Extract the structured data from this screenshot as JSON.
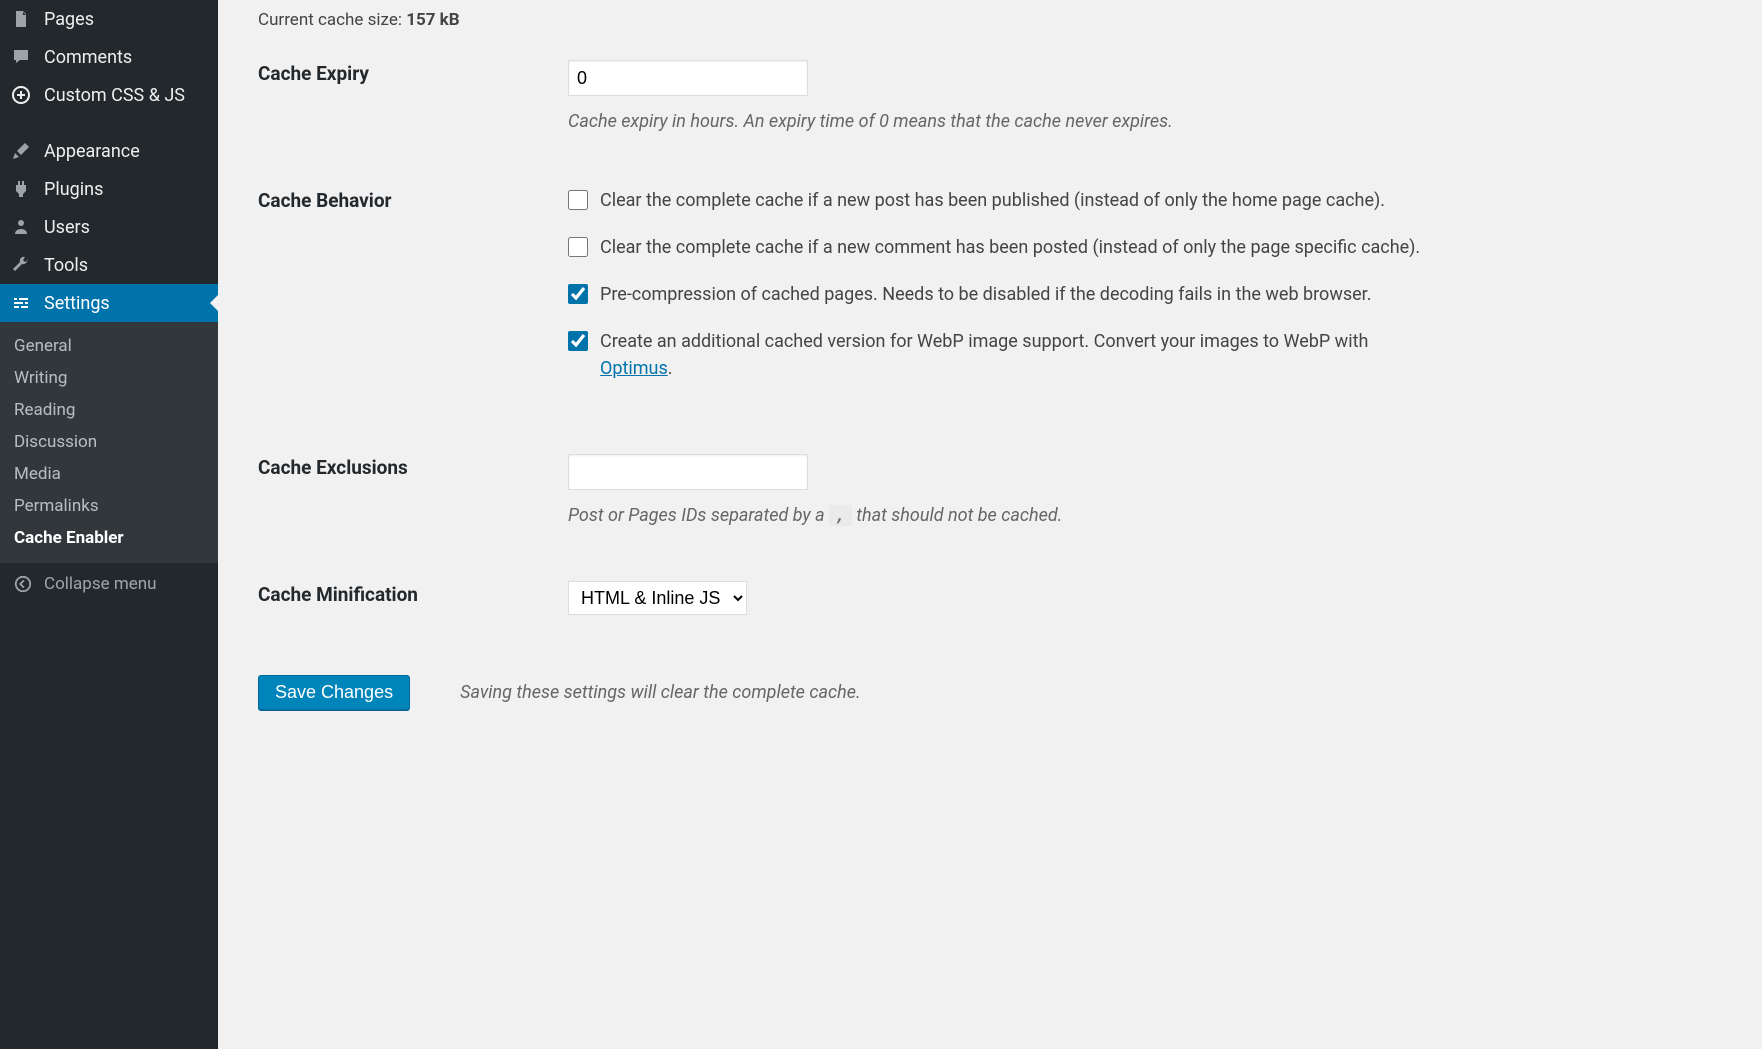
{
  "sidebar": {
    "items": [
      {
        "label": "Pages"
      },
      {
        "label": "Comments"
      },
      {
        "label": "Custom CSS & JS"
      },
      {
        "label": "Appearance"
      },
      {
        "label": "Plugins"
      },
      {
        "label": "Users"
      },
      {
        "label": "Tools"
      },
      {
        "label": "Settings"
      }
    ],
    "submenu": [
      {
        "label": "General"
      },
      {
        "label": "Writing"
      },
      {
        "label": "Reading"
      },
      {
        "label": "Discussion"
      },
      {
        "label": "Media"
      },
      {
        "label": "Permalinks"
      },
      {
        "label": "Cache Enabler"
      }
    ],
    "collapse": "Collapse menu"
  },
  "cacheSize": {
    "label": "Current cache size: ",
    "value": "157 kB"
  },
  "form": {
    "expiry": {
      "label": "Cache Expiry",
      "value": "0",
      "hint": "Cache expiry in hours. An expiry time of 0 means that the cache never expires."
    },
    "behavior": {
      "label": "Cache Behavior",
      "opt1": "Clear the complete cache if a new post has been published (instead of only the home page cache).",
      "opt2": "Clear the complete cache if a new comment has been posted (instead of only the page specific cache).",
      "opt3": "Pre-compression of cached pages. Needs to be disabled if the decoding fails in the web browser.",
      "opt4a": "Create an additional cached version for WebP image support. Convert your images to WebP with ",
      "opt4link": "Optimus",
      "opt4b": "."
    },
    "exclusions": {
      "label": "Cache Exclusions",
      "value": "",
      "hint_a": "Post or Pages IDs separated by a ",
      "hint_code": ",",
      "hint_b": " that should not be cached."
    },
    "minification": {
      "label": "Cache Minification",
      "selected": "HTML & Inline JS"
    },
    "save": {
      "button": "Save Changes",
      "hint": "Saving these settings will clear the complete cache."
    }
  }
}
